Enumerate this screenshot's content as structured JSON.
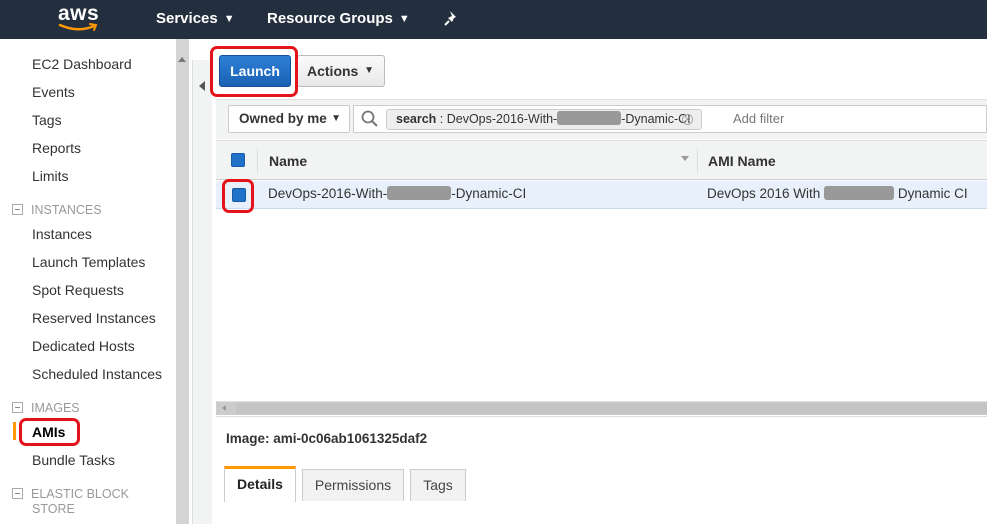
{
  "topbar": {
    "logo": "aws",
    "nav": [
      {
        "label": "Services",
        "icon": "chevron-down-icon"
      },
      {
        "label": "Resource Groups",
        "icon": "chevron-down-icon"
      }
    ],
    "pin_icon": "pin-icon"
  },
  "sidebar": {
    "top_links": [
      "EC2 Dashboard",
      "Events",
      "Tags",
      "Reports",
      "Limits"
    ],
    "sections": [
      {
        "title": "INSTANCES",
        "items": [
          "Instances",
          "Launch Templates",
          "Spot Requests",
          "Reserved Instances",
          "Dedicated Hosts",
          "Scheduled Instances"
        ]
      },
      {
        "title": "IMAGES",
        "items": [
          "AMIs",
          "Bundle Tasks"
        ],
        "active": "AMIs"
      },
      {
        "title": "ELASTIC BLOCK",
        "title2": "STORE",
        "items": []
      }
    ]
  },
  "toolbar": {
    "launch_label": "Launch",
    "actions_label": "Actions"
  },
  "filter": {
    "owner_select": "Owned by me",
    "token_key": "search",
    "token_sep": " : ",
    "token_prefix": "DevOps-2016-With-",
    "token_suffix": "-Dynamic-CI",
    "add_filter_placeholder": "Add filter"
  },
  "table": {
    "columns": [
      "Name",
      "AMI Name"
    ],
    "rows": [
      {
        "selected": true,
        "name_prefix": "DevOps-2016-With-",
        "name_suffix": "-Dynamic-CI",
        "ami_prefix": "DevOps 2016 With ",
        "ami_suffix": " Dynamic CI"
      }
    ]
  },
  "detail": {
    "image_label": "Image: ami-0c06ab1061325daf2",
    "tabs": [
      "Details",
      "Permissions",
      "Tags"
    ],
    "active_tab": "Details"
  },
  "colors": {
    "topbar": "#232f3e",
    "primary_button": "#1a62b4",
    "accent": "#ff9900",
    "highlight": "#e3121b"
  }
}
